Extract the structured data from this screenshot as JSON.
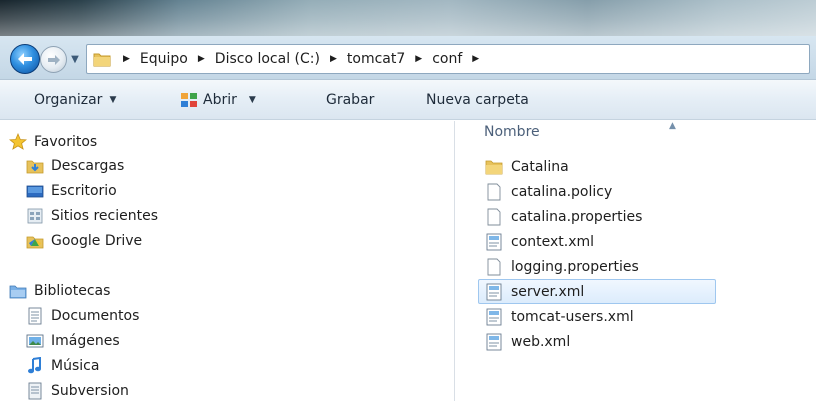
{
  "address_bar": {
    "crumbs": [
      "Equipo",
      "Disco local (C:)",
      "tomcat7",
      "conf"
    ]
  },
  "toolbar": {
    "organize_label": "Organizar",
    "open_label": "Abrir",
    "burn_label": "Grabar",
    "new_folder_label": "Nueva carpeta"
  },
  "nav_pane": {
    "favorites_label": "Favoritos",
    "favorites": [
      "Descargas",
      "Escritorio",
      "Sitios recientes",
      "Google Drive"
    ],
    "libraries_label": "Bibliotecas",
    "libraries": [
      "Documentos",
      "Imágenes",
      "Música",
      "Subversion"
    ]
  },
  "file_list": {
    "column_header": "Nombre",
    "files": [
      {
        "name": "Catalina",
        "icon": "folder-icon"
      },
      {
        "name": "catalina.policy",
        "icon": "file-icon"
      },
      {
        "name": "catalina.properties",
        "icon": "file-icon"
      },
      {
        "name": "context.xml",
        "icon": "xml-file-icon"
      },
      {
        "name": "logging.properties",
        "icon": "file-icon"
      },
      {
        "name": "server.xml",
        "icon": "xml-file-icon"
      },
      {
        "name": "tomcat-users.xml",
        "icon": "xml-file-icon"
      },
      {
        "name": "web.xml",
        "icon": "xml-file-icon"
      }
    ],
    "selected": "server.xml"
  },
  "colors": {
    "selection_bg": "#dcecfc",
    "selection_border": "#9fc7ef",
    "header_text": "#4c607a"
  }
}
